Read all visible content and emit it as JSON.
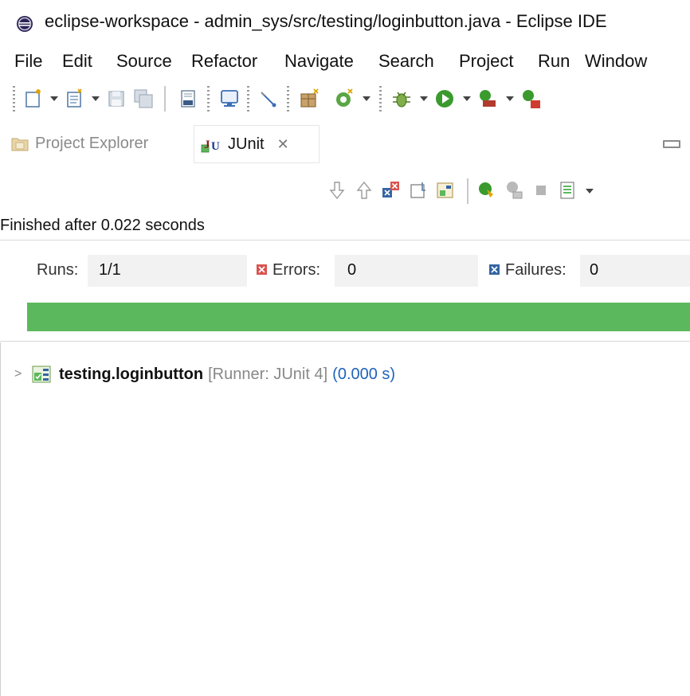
{
  "window": {
    "title": "eclipse-workspace - admin_sys/src/testing/loginbutton.java - Eclipse IDE",
    "app_icon": "eclipse-icon"
  },
  "menu": {
    "items": [
      {
        "label": "File"
      },
      {
        "label": "Edit"
      },
      {
        "label": "Source"
      },
      {
        "label": "Refactor"
      },
      {
        "label": "Navigate"
      },
      {
        "label": "Search"
      },
      {
        "label": "Project"
      },
      {
        "label": "Run"
      },
      {
        "label": "Window"
      }
    ]
  },
  "toolbar": {
    "icons": [
      "new-icon",
      "new-file-icon",
      "save-icon",
      "save-all-icon",
      "binary-icon",
      "console-icon",
      "pen-icon",
      "new-package-icon",
      "refresh-icon",
      "debug-icon",
      "run-icon",
      "external-tools-icon",
      "coverage-icon"
    ]
  },
  "tabs": {
    "project_explorer": "Project Explorer",
    "junit": "JUnit",
    "close_glyph": "✕"
  },
  "junit_view": {
    "status": "Finished after 0.022 seconds",
    "runs_label": "Runs:",
    "runs_value": "1/1",
    "errors_label": "Errors:",
    "errors_value": "0",
    "failures_label": "Failures:",
    "failures_value": "0",
    "progress_fraction": 1.0,
    "progress_color": "#5cb85c",
    "tree": [
      {
        "name": "testing.loginbutton",
        "runner": "[Runner: JUnit 4]",
        "time": "(0.000 s)"
      }
    ]
  },
  "colors": {
    "success": "#5cb85c",
    "error": "#d9534f",
    "failure": "#3465a4",
    "time_text": "#1f63b8"
  }
}
